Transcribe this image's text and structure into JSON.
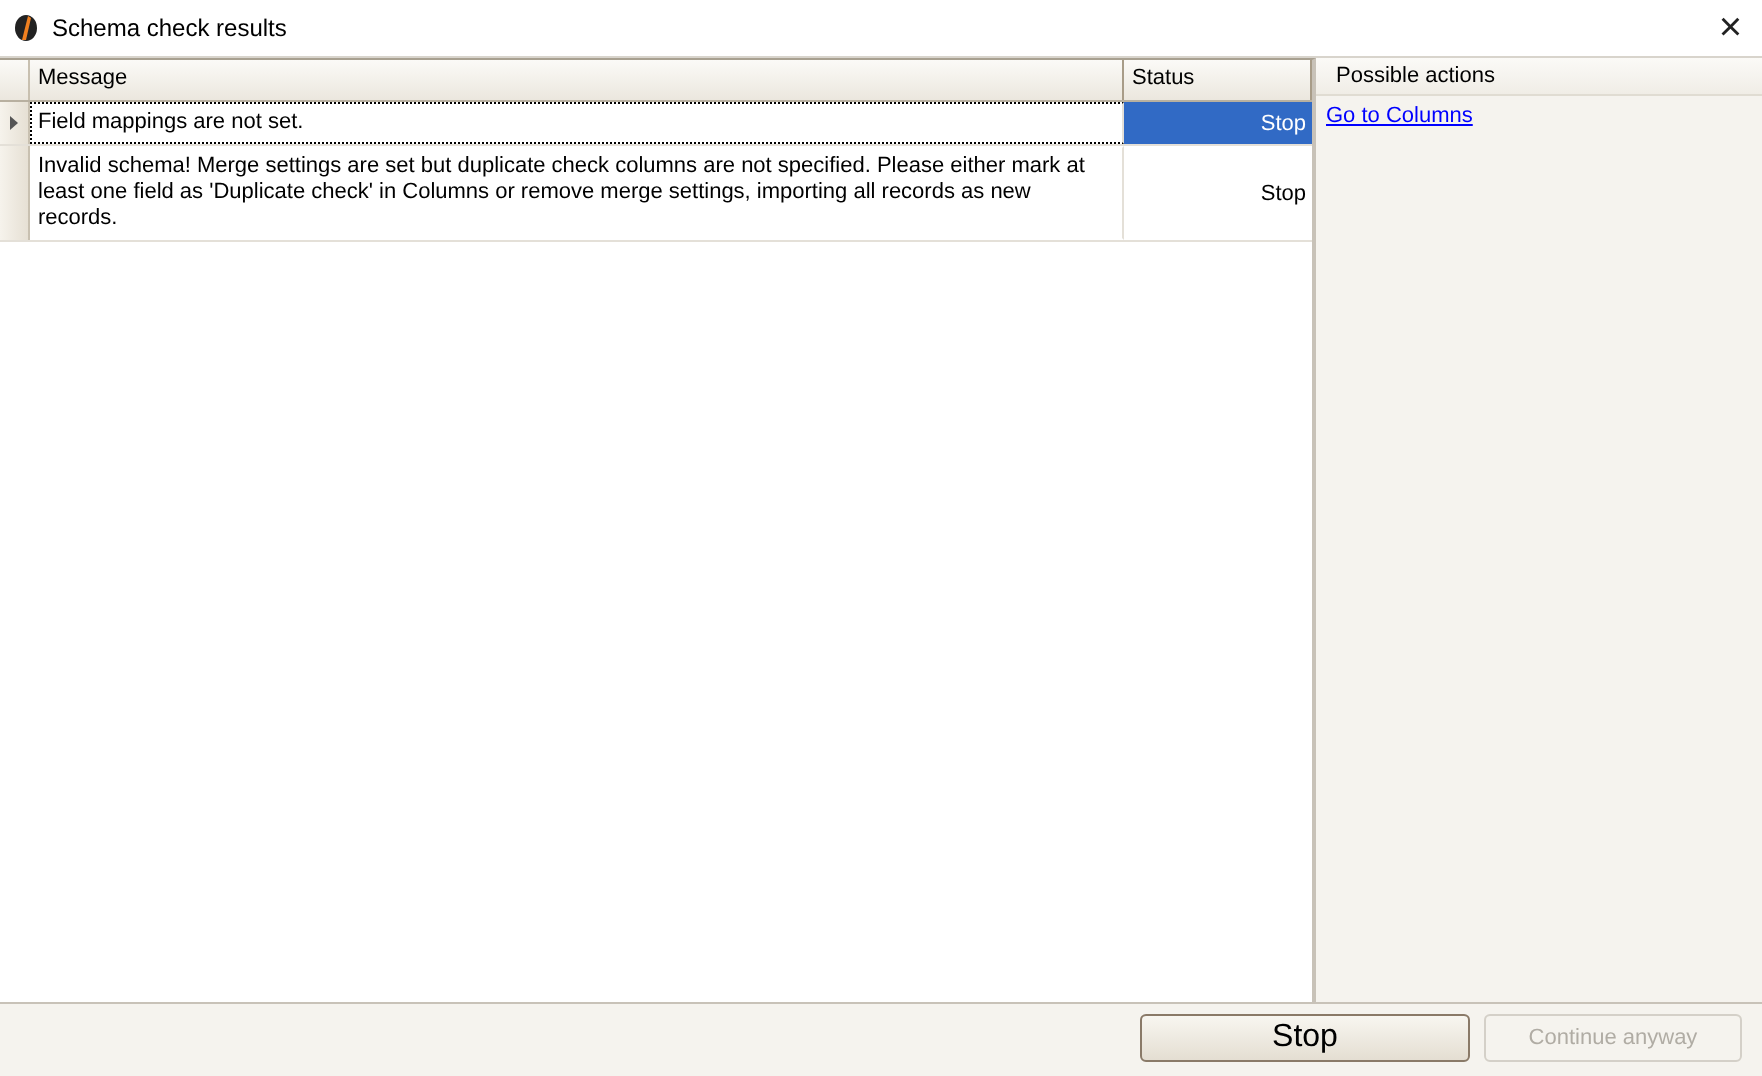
{
  "window": {
    "title": "Schema check results",
    "close": "×"
  },
  "table": {
    "columns": [
      "Message",
      "Status"
    ],
    "rows": [
      {
        "message": "Field mappings are not set.",
        "status": "Stop",
        "selected": true
      },
      {
        "message": "Invalid schema! Merge settings are set but duplicate check columns are not specified. Please either mark at least one field as 'Duplicate check' in Columns or remove merge settings, importing all records as new records.",
        "status": "Stop",
        "selected": false
      }
    ]
  },
  "actions_panel": {
    "title": "Possible actions",
    "links": [
      "Go to Columns"
    ]
  },
  "buttons": [
    {
      "label": "Stop",
      "disabled": false
    },
    {
      "label": "Continue anyway",
      "disabled": true
    }
  ]
}
